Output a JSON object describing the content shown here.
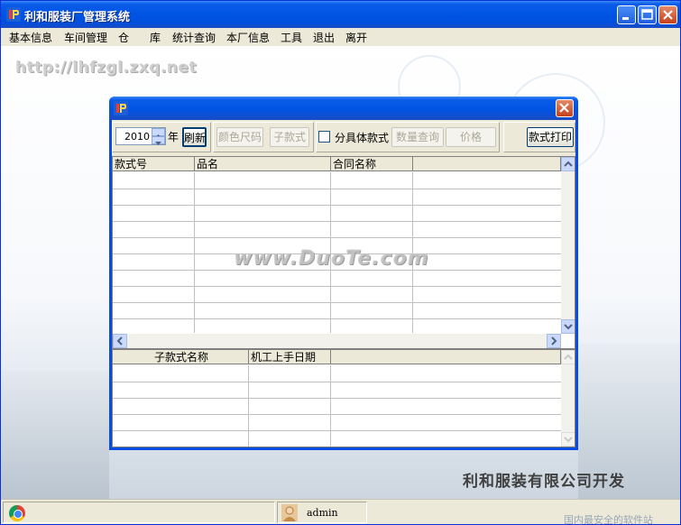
{
  "window": {
    "title": "利和服装厂管理系统"
  },
  "menu": {
    "items": [
      "基本信息",
      "车间管理",
      "仓",
      "库",
      "统计查询",
      "本厂信息",
      "工具",
      "退出",
      "离开"
    ]
  },
  "background": {
    "url_text": "http://lhfzgl.zxq.net",
    "company_text": "利和服装有限公司开发"
  },
  "dialog": {
    "toolbar": {
      "year": "2010",
      "year_label": "年",
      "refresh_label": "刷新",
      "color_size_label": "颜色尺码",
      "sub_style_label": "子款式",
      "split_checkbox_label": "分具体款式",
      "quantity_query_label": "数量查询",
      "price_label": "价格",
      "print_label": "款式打印"
    },
    "top_grid": {
      "headers": [
        "款式号",
        "品名",
        "合同名称"
      ]
    },
    "bottom_grid": {
      "headers": [
        "子款式名称",
        "机工上手日期"
      ]
    },
    "watermark": "www.DuoTe.com"
  },
  "status": {
    "user": "admin",
    "watermark": "国内最安全的软件站"
  }
}
